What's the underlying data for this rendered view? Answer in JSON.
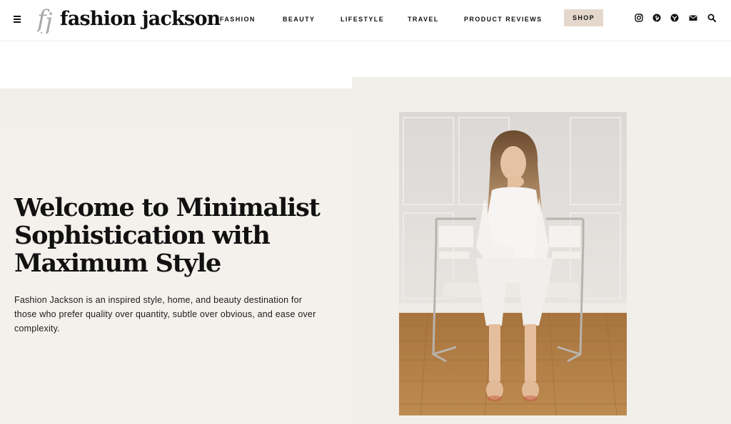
{
  "header": {
    "logo_text": "fashion jackson",
    "menu_icon": "hamburger-menu-icon",
    "nav": {
      "fashion": "FASHION",
      "beauty": "BEAUTY",
      "lifestyle": "LIFESTYLE",
      "travel": "TRAVEL",
      "product_reviews": "PRODUCT REVIEWS"
    },
    "shop_label": "SHOP",
    "social_icons": [
      "instagram-icon",
      "pinterest-icon",
      "ltk-icon",
      "email-icon",
      "search-icon"
    ]
  },
  "hero": {
    "title": "Welcome to Minimalist Sophistication with Maximum Style",
    "description": "Fashion Jackson is an inspired style, home, and beauty destination for those who prefer quality over quantity, subtle over obvious, and ease over complexity."
  },
  "colors": {
    "shop_button_bg": "#e4d8cc",
    "hero_bg": "#f4f1ec",
    "hero_bg_alt": "#f1efea",
    "text": "#111111"
  }
}
